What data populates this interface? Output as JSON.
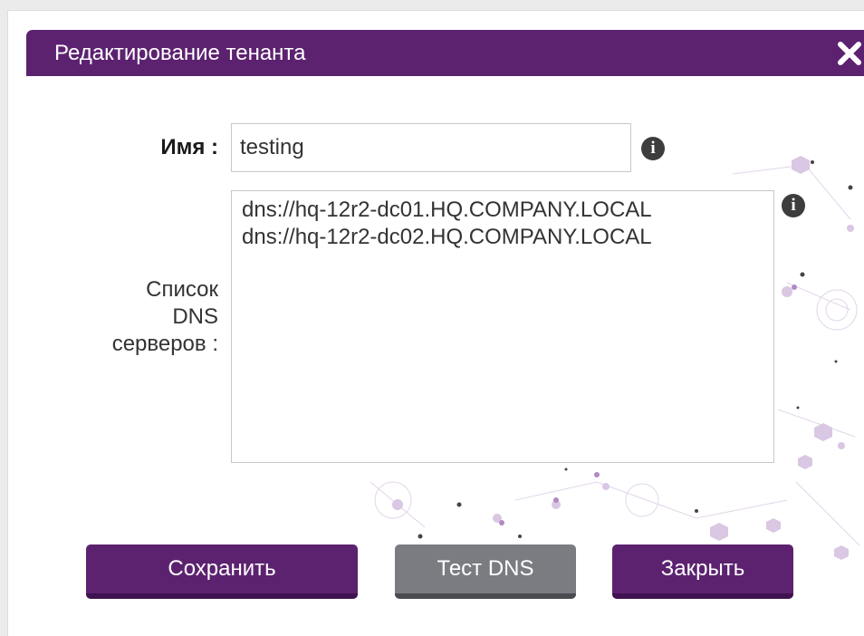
{
  "dialog": {
    "title": "Редактирование тенанта",
    "close_icon": "close-x-icon"
  },
  "form": {
    "name_label": "Имя :",
    "name_value": "testing",
    "dns_label_line1": "Список",
    "dns_label_line2": "DNS",
    "dns_label_line3": "серверов :",
    "dns_value": "dns://hq-12r2-dc01.HQ.COMPANY.LOCAL\ndns://hq-12r2-dc02.HQ.COMPANY.LOCAL",
    "info_icon": "info-icon",
    "info_glyph": "i"
  },
  "buttons": {
    "save_label": "Сохранить",
    "test_dns_label": "Тест DNS",
    "close_label": "Закрыть"
  },
  "colors": {
    "brand_purple": "#5c2270",
    "button_gray": "#7b7c82"
  }
}
